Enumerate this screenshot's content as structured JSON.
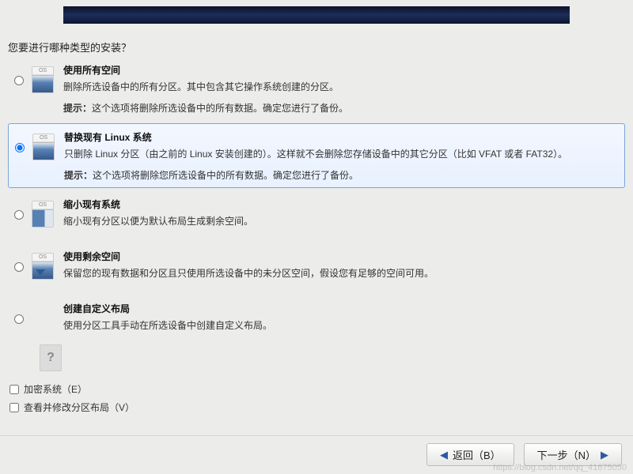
{
  "question": "您要进行哪种类型的安装？",
  "options": [
    {
      "title": "使用所有空间",
      "description": "删除所选设备中的所有分区。其中包含其它操作系统创建的分区。",
      "hint_label": "提示：",
      "hint_body": "这个选项将删除所选设备中的所有数据。确定您进行了备份。",
      "selected": false,
      "icon": "disk-all-icon"
    },
    {
      "title": "替换现有 Linux 系统",
      "description": "只删除 Linux 分区（由之前的 Linux 安装创建的）。这样就不会删除您存储设备中的其它分区（比如 VFAT 或者 FAT32）。",
      "hint_label": "提示：",
      "hint_body": "这个选项将删除您所选设备中的所有数据。确定您进行了备份。",
      "selected": true,
      "icon": "disk-replace-icon"
    },
    {
      "title": "缩小现有系统",
      "description": "缩小现有分区以便为默认布局生成剩余空间。",
      "hint_label": "",
      "hint_body": "",
      "selected": false,
      "icon": "disk-shrink-icon"
    },
    {
      "title": "使用剩余空间",
      "description": "保留您的现有数据和分区且只使用所选设备中的未分区空间，假设您有足够的空间可用。",
      "hint_label": "",
      "hint_body": "",
      "selected": false,
      "icon": "disk-free-icon"
    },
    {
      "title": "创建自定义布局",
      "description": "使用分区工具手动在所选设备中创建自定义布局。",
      "hint_label": "",
      "hint_body": "",
      "selected": false,
      "icon": "disk-custom-icon"
    }
  ],
  "checkboxes": {
    "encrypt": "加密系统（E）",
    "review": "查看并修改分区布局（V）"
  },
  "buttons": {
    "back": "返回（B）",
    "next": "下一步（N）"
  },
  "watermark": "https://blog.csdn.net/qq_41675050"
}
